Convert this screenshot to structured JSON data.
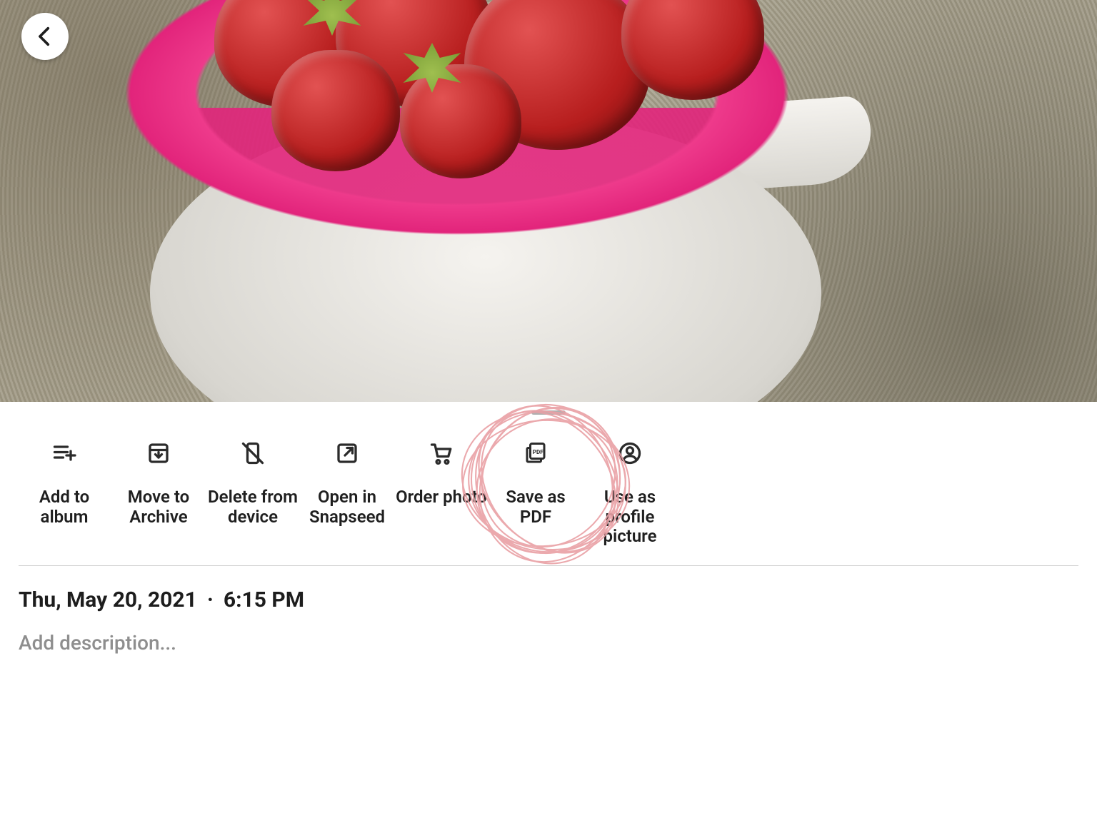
{
  "actions": {
    "add_to_album": "Add to\nalbum",
    "move_to_archive": "Move to\nArchive",
    "delete_from_device": "Delete from\ndevice",
    "open_in_snapseed": "Open in\nSnapseed",
    "order_photo": "Order photo",
    "save_as_pdf": "Save as PDF",
    "use_as_profile": "Use as\nprofile\npicture"
  },
  "meta": {
    "date": "Thu, May 20, 2021",
    "separator": "·",
    "time": "6:15 PM"
  },
  "description_placeholder": "Add description...",
  "highlight": {
    "target_action": "save_as_pdf",
    "stroke": "#e9a0a5"
  }
}
